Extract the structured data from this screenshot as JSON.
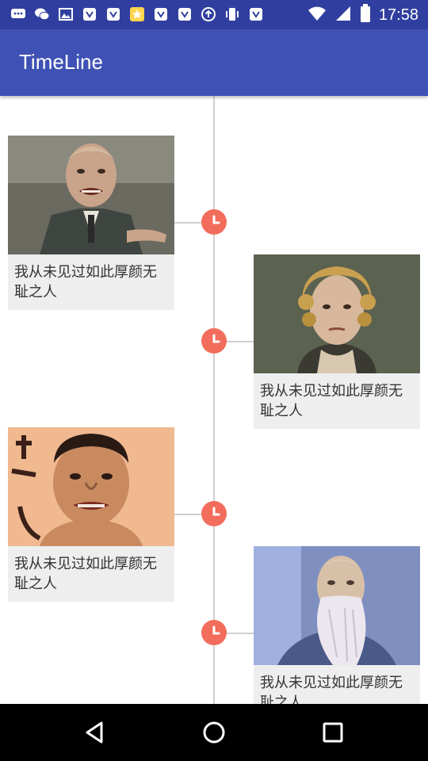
{
  "status_bar": {
    "time": "17:58",
    "left_icons": [
      "chat-icon",
      "wechat-icon",
      "gallery-icon",
      "app-icon",
      "app-icon",
      "star-app-icon",
      "app-icon",
      "app-icon",
      "upload-icon",
      "vibrate-icon",
      "app-icon"
    ],
    "right_icons": [
      "wifi-icon",
      "signal-icon",
      "battery-icon"
    ]
  },
  "app_bar": {
    "title": "TimeLine"
  },
  "timeline": {
    "items": [
      {
        "side": "left",
        "caption": "我从未见过如此厚颜无耻之人",
        "image": "bald-man-in-uniform"
      },
      {
        "side": "right",
        "caption": "我从未见过如此厚颜无耻之人",
        "image": "woman-with-blond-curls"
      },
      {
        "side": "left",
        "caption": "我从未见过如此厚颜无耻之人",
        "image": "man-with-short-hair"
      },
      {
        "side": "right",
        "caption": "我从未见过如此厚颜无耻之人",
        "image": "old-man-with-white-beard"
      }
    ]
  },
  "colors": {
    "status_bar": "#303F9F",
    "app_bar": "#3F51B5",
    "node": "#F26D5B",
    "card": "#eeeeee",
    "axis": "#d0d0d0"
  },
  "nav_bar": {
    "buttons": [
      "back-icon",
      "home-icon",
      "recents-icon"
    ]
  }
}
